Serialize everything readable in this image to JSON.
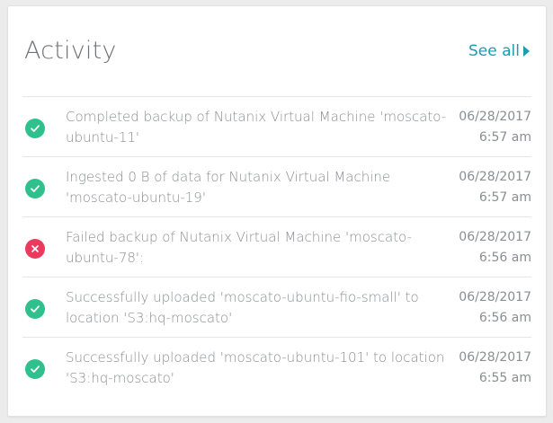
{
  "panel": {
    "title": "Activity",
    "see_all_label": "See all"
  },
  "colors": {
    "success": "#2fc08d",
    "error": "#ea3b5f",
    "link": "#1f9bb0"
  },
  "activities": [
    {
      "status": "success",
      "icon": "check-icon",
      "message": "Completed backup of Nutanix Virtual Machine 'moscato-ubuntu-11'",
      "date": "06/28/2017",
      "time": "6:57 am"
    },
    {
      "status": "success",
      "icon": "check-icon",
      "message": "Ingested 0 B of data for Nutanix Virtual Machine 'moscato-ubuntu-19'",
      "date": "06/28/2017",
      "time": "6:57 am"
    },
    {
      "status": "error",
      "icon": "x-icon",
      "message": "Failed backup of Nutanix Virtual Machine 'moscato-ubuntu-78':",
      "date": "06/28/2017",
      "time": "6:56 am"
    },
    {
      "status": "success",
      "icon": "check-icon",
      "message": "Successfully uploaded 'moscato-ubuntu-fio-small' to location 'S3:hq-moscato'",
      "date": "06/28/2017",
      "time": "6:56 am"
    },
    {
      "status": "success",
      "icon": "check-icon",
      "message": "Successfully uploaded 'moscato-ubuntu-101' to location 'S3:hq-moscato'",
      "date": "06/28/2017",
      "time": "6:55 am"
    }
  ]
}
